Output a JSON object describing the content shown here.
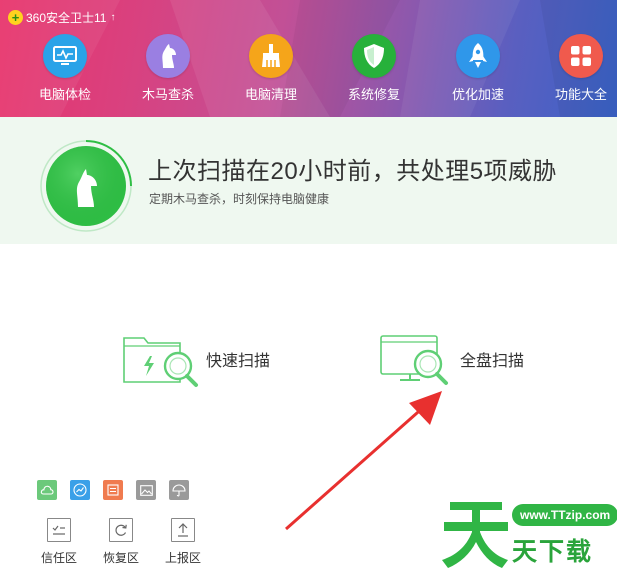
{
  "app": {
    "title": "360安全卫士11",
    "upgrade_icon": "up-arrow-icon",
    "logo_glyph": "+"
  },
  "nav": {
    "items": [
      {
        "label": "电脑体检",
        "icon": "monitor-checkup-icon",
        "color": "#2aa3e8"
      },
      {
        "label": "木马查杀",
        "icon": "horse-shield-icon",
        "color": "#9a7fe2"
      },
      {
        "label": "电脑清理",
        "icon": "broom-icon",
        "color": "#f5a51a"
      },
      {
        "label": "系统修复",
        "icon": "shield-repair-icon",
        "color": "#27b13b"
      },
      {
        "label": "优化加速",
        "icon": "rocket-icon",
        "color": "#2f97ea"
      },
      {
        "label": "功能大全",
        "icon": "grid-apps-icon",
        "color": "#f05a4d"
      }
    ]
  },
  "status": {
    "title": "上次扫描在20小时前，共处理5项威胁",
    "subtitle": "定期木马查杀，时刻保持电脑健康",
    "accent": "#2fbe45"
  },
  "scan": {
    "quick_label": "快速扫描",
    "full_label": "全盘扫描",
    "line_color": "#5fcf75"
  },
  "mini_tools": [
    {
      "icon": "cloud-icon",
      "color": "#6cc97b"
    },
    {
      "icon": "trend-icon",
      "color": "#3aa0e8"
    },
    {
      "icon": "document-icon",
      "color": "#f07b4f"
    },
    {
      "icon": "image-icon",
      "color": "#9a9a9a"
    },
    {
      "icon": "umbrella-icon",
      "color": "#9a9a9a"
    }
  ],
  "zones": [
    {
      "label": "信任区",
      "icon": "trust-zone-icon"
    },
    {
      "label": "恢复区",
      "icon": "restore-zone-icon"
    },
    {
      "label": "上报区",
      "icon": "upload-zone-icon"
    }
  ],
  "watermark": {
    "url": "www.TTzip.com",
    "text": "天下载"
  }
}
